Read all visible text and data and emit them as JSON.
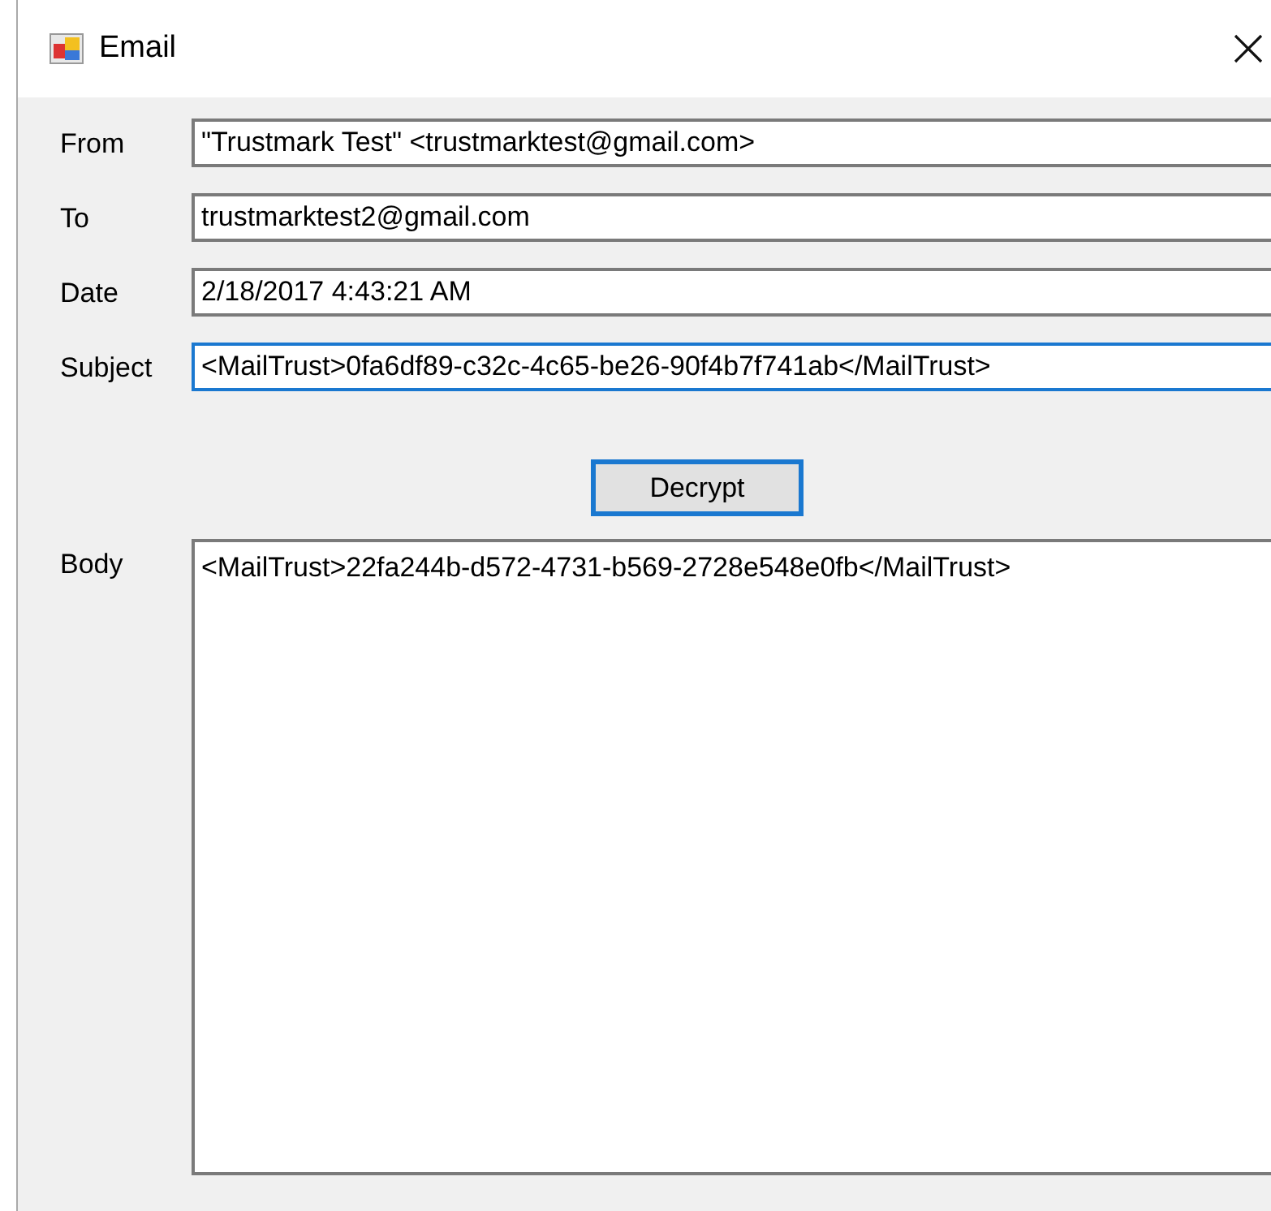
{
  "window": {
    "title": "Email"
  },
  "fields": [
    {
      "label": "From",
      "value": "\"Trustmark Test\" <trustmarktest@gmail.com>",
      "focused": false
    },
    {
      "label": "To",
      "value": "trustmarktest2@gmail.com",
      "focused": false
    },
    {
      "label": "Date",
      "value": "2/18/2017 4:43:21 AM",
      "focused": false
    },
    {
      "label": "Subject",
      "value": "<MailTrust>0fa6df89-c32c-4c65-be26-90f4b7f741ab</MailTrust>",
      "focused": true
    }
  ],
  "button": {
    "label": "Decrypt",
    "focused": true
  },
  "body": {
    "label": "Body",
    "value": "<MailTrust>22fa244b-d572-4731-b569-2728e548e0fb</MailTrust>"
  }
}
